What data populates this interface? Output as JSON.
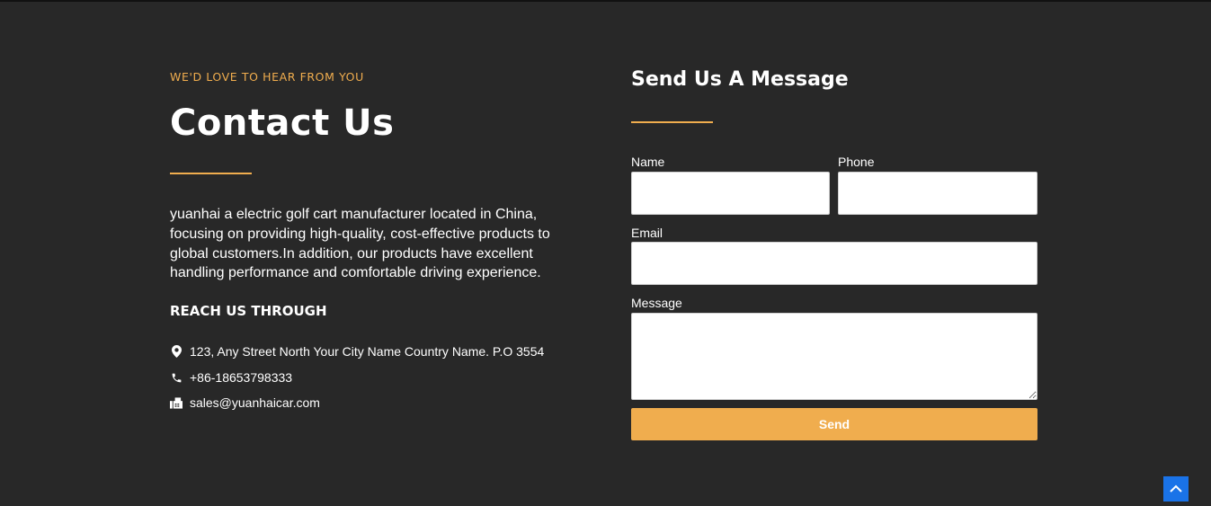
{
  "contact": {
    "eyebrow": "WE'D LOVE TO HEAR FROM YOU",
    "heading": "Contact Us",
    "description": "yuanhai a electric golf cart manufacturer located in China, focusing on providing high-quality, cost-effective products to global customers.In addition, our products have excellent handling performance and comfortable driving experience.",
    "reach_title": "REACH US THROUGH",
    "items": [
      {
        "icon": "map-pin-icon",
        "text": "123, Any Street North Your City Name Country Name. P.O 3554"
      },
      {
        "icon": "phone-icon",
        "text": "+86-18653798333"
      },
      {
        "icon": "fax-icon",
        "text": "sales@yuanhaicar.com"
      }
    ]
  },
  "form": {
    "title": "Send Us A Message",
    "name_label": "Name",
    "phone_label": "Phone",
    "email_label": "Email",
    "message_label": "Message",
    "name_value": "",
    "phone_value": "",
    "email_value": "",
    "message_value": "",
    "send_label": "Send"
  },
  "colors": {
    "background": "#282828",
    "accent": "#f0ad4e",
    "scroll_button": "#1a73e8"
  }
}
